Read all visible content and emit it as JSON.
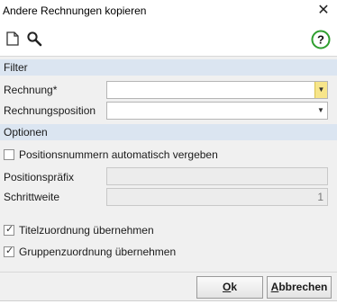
{
  "window": {
    "title": "Andere Rechnungen kopieren",
    "close_glyph": "✕"
  },
  "toolbar": {
    "icons": [
      "new-document-icon",
      "search-icon",
      "help-icon"
    ]
  },
  "sections": {
    "filter": "Filter",
    "options": "Optionen"
  },
  "filter": {
    "invoice_label": "Rechnung*",
    "invoice_value": "",
    "position_label": "Rechnungsposition",
    "position_value": ""
  },
  "options": {
    "auto_numbering_label": "Positionsnummern automatisch vergeben",
    "auto_numbering_checked": false,
    "prefix_label": "Positionspräfix",
    "prefix_value": "",
    "step_label": "Schrittweite",
    "step_value": "1",
    "title_assign_label": "Titelzuordnung übernehmen",
    "title_assign_checked": true,
    "group_assign_label": "Gruppenzuordnung übernehmen",
    "group_assign_checked": true
  },
  "buttons": {
    "ok_mnemonic": "O",
    "ok_rest": "k",
    "cancel_mnemonic": "A",
    "cancel_rest": "bbrechen"
  },
  "colors": {
    "section_header": "#dbe5f1",
    "required_arrow": "#f7e58a",
    "help_icon": "#2e9e2e"
  }
}
